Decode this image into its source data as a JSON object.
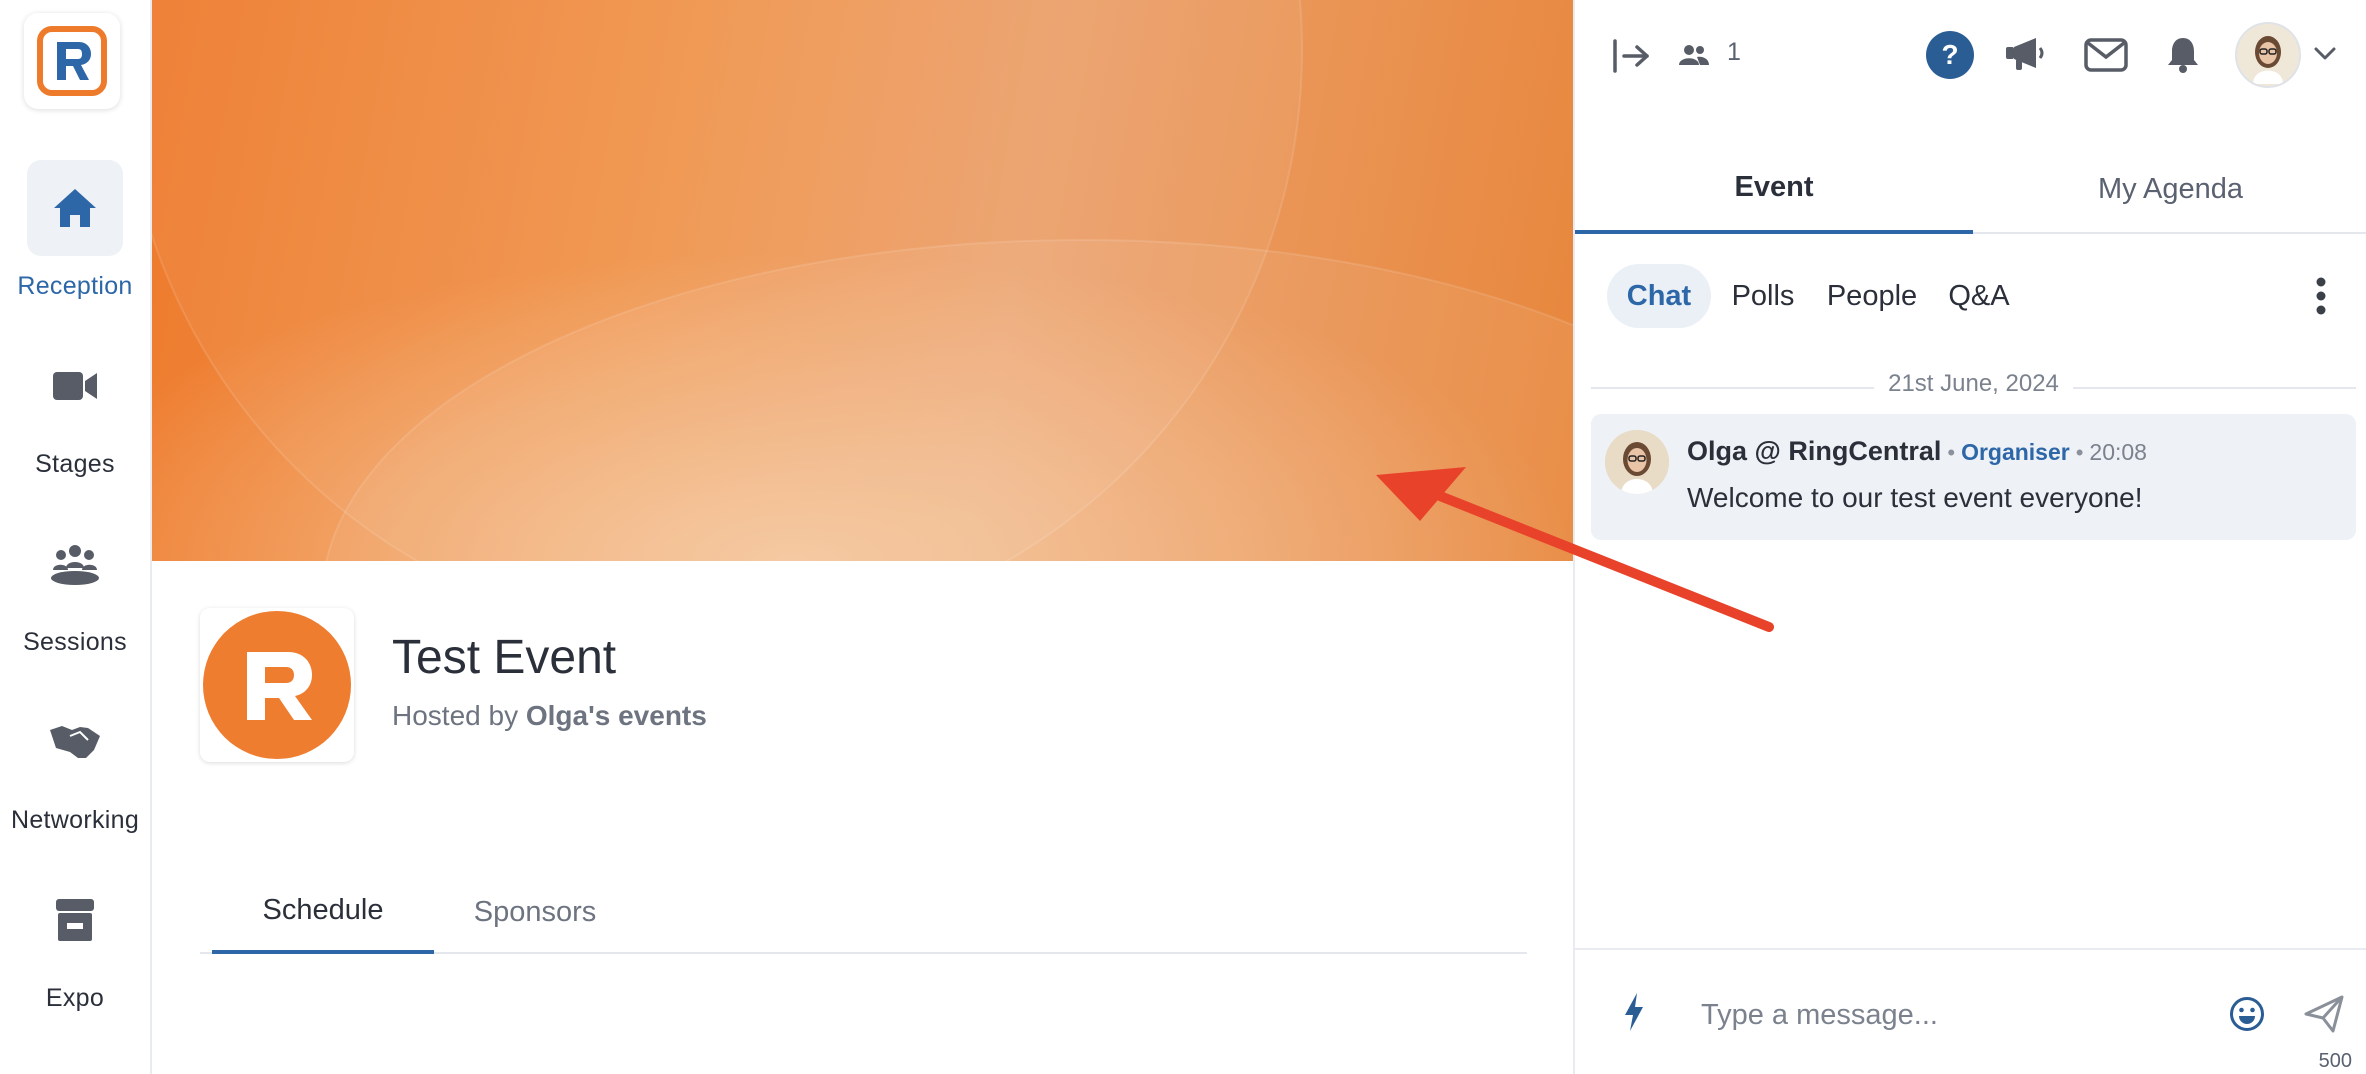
{
  "brand": {
    "logo_icon": "ringcentral-r-logo-icon",
    "accent": "#2d67a8",
    "orange": "#ee7a2c"
  },
  "sidebar": {
    "items": [
      {
        "label": "Reception",
        "icon": "home-icon",
        "active": true
      },
      {
        "label": "Stages",
        "icon": "video-camera-icon",
        "active": false
      },
      {
        "label": "Sessions",
        "icon": "group-sessions-icon",
        "active": false
      },
      {
        "label": "Networking",
        "icon": "handshake-icon",
        "active": false
      },
      {
        "label": "Expo",
        "icon": "booth-icon",
        "active": false
      }
    ]
  },
  "event": {
    "title": "Test Event",
    "hosted_prefix": "Hosted by",
    "host": "Olga's events",
    "tabs": [
      {
        "label": "Schedule",
        "active": true
      },
      {
        "label": "Sponsors",
        "active": false
      }
    ]
  },
  "topbar": {
    "people_count": "1",
    "icons": [
      "exit-icon",
      "people-icon",
      "help-icon",
      "megaphone-icon",
      "mail-icon",
      "bell-icon",
      "user-avatar",
      "chevron-down-icon"
    ]
  },
  "panel": {
    "tabs": [
      {
        "label": "Event",
        "active": true
      },
      {
        "label": "My Agenda",
        "active": false
      }
    ],
    "subtabs": [
      {
        "label": "Chat",
        "active": true
      },
      {
        "label": "Polls",
        "active": false
      },
      {
        "label": "People",
        "active": false
      },
      {
        "label": "Q&A",
        "active": false
      }
    ],
    "date": "21st June, 2024",
    "messages": [
      {
        "author": "Olga @ RingCentral",
        "role": "Organiser",
        "time": "20:08",
        "text": "Welcome to our test event everyone!"
      }
    ],
    "composer": {
      "placeholder": "Type a message...",
      "char_limit": "500"
    }
  },
  "annotation": {
    "color": "#e8432a"
  }
}
